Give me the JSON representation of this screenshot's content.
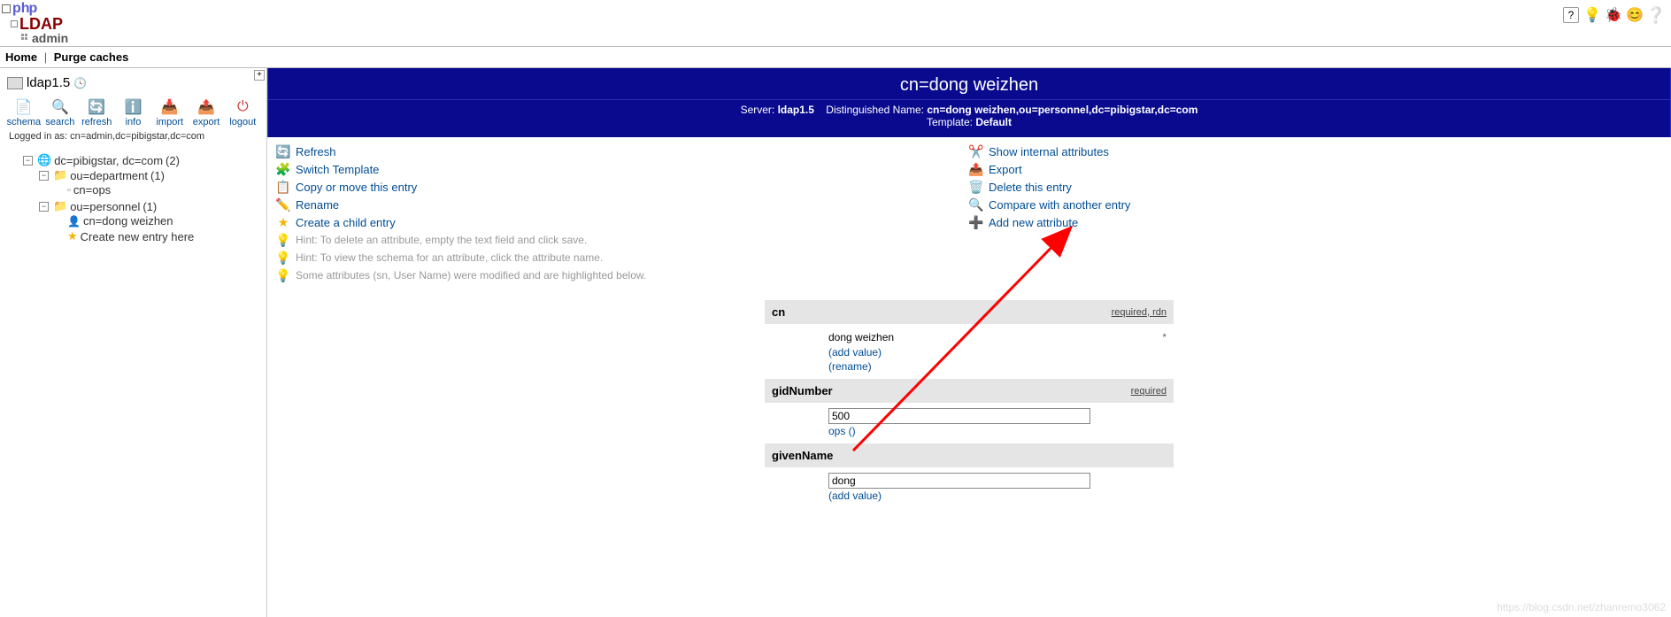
{
  "logo": {
    "row1": "php",
    "row2": "LDAP",
    "row3": "admin"
  },
  "top_icons": {
    "help": "?",
    "bulb": "💡",
    "bug": "🐞",
    "smile": "😊",
    "support": "❓"
  },
  "menu": {
    "home": "Home",
    "purge": "Purge caches"
  },
  "left": {
    "server_name": "ldap1.5",
    "toolbar": {
      "schema": "schema",
      "search": "search",
      "refresh": "refresh",
      "info": "info",
      "import": "import",
      "export": "export",
      "logout": "logout"
    },
    "logged_in_prefix": "Logged in as: ",
    "logged_in_dn": "cn=admin,dc=pibigstar,dc=com",
    "tree": {
      "root": "dc=pibigstar, dc=com",
      "root_count": "(2)",
      "dept": "ou=department",
      "dept_count": "(1)",
      "dept_child": "cn=ops",
      "pers": "ou=personnel",
      "pers_count": "(1)",
      "pers_child": "cn=dong weizhen",
      "create_here": "Create new entry here"
    }
  },
  "entry": {
    "title": "cn=dong weizhen",
    "server_label": "Server:",
    "server_value": "ldap1.5",
    "dn_label": "Distinguished Name:",
    "dn_value": "cn=dong weizhen,ou=personnel,dc=pibigstar,dc=com",
    "template_label": "Template:",
    "template_value": "Default"
  },
  "actions_left": {
    "refresh": "Refresh",
    "switch_template": "Switch Template",
    "copy_move": "Copy or move this entry",
    "rename": "Rename",
    "create_child": "Create a child entry",
    "hint_delete": "Hint: To delete an attribute, empty the text field and click save.",
    "hint_schema": "Hint: To view the schema for an attribute, click the attribute name.",
    "hint_modified": "Some attributes (sn, User Name) were modified and are highlighted below."
  },
  "actions_right": {
    "show_internal": "Show internal attributes",
    "export": "Export",
    "delete": "Delete this entry",
    "compare": "Compare with another entry",
    "add_attr": "Add new attribute"
  },
  "attrs": {
    "cn": {
      "name": "cn",
      "flags_required": "required",
      "flags_rdn": "rdn",
      "value": "dong weizhen",
      "add_value": "(add value)",
      "rename": "(rename)"
    },
    "gid": {
      "name": "gidNumber",
      "flags_required": "required",
      "value": "500",
      "sub": "ops ()"
    },
    "givenName": {
      "name": "givenName",
      "value": "dong",
      "add_value": "(add value)"
    }
  },
  "watermark": "https://blog.csdn.net/zhanremo3062"
}
